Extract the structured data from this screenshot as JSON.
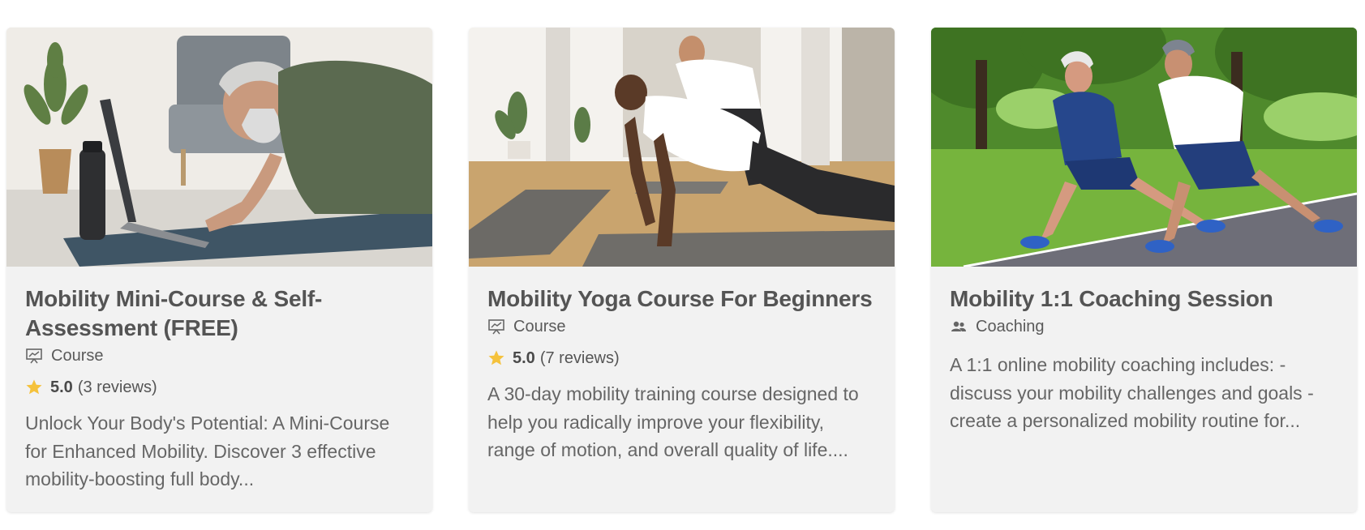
{
  "cards": [
    {
      "title": "Mobility Mini-Course & Self-Assessment (FREE)",
      "type_label": "Course",
      "type_icon": "presentation-chart-icon",
      "rating_score": "5.0",
      "rating_reviews": "(3 reviews)",
      "description": "Unlock Your Body's Potential: A Mini-Course for Enhanced Mobility. Discover 3 effective mobility-boosting full body..."
    },
    {
      "title": "Mobility Yoga Course For Beginners",
      "type_label": "Course",
      "type_icon": "presentation-chart-icon",
      "rating_score": "5.0",
      "rating_reviews": "(7 reviews)",
      "description": "A 30-day mobility training course designed to help you radically improve your flexibility, range of motion, and overall quality of life...."
    },
    {
      "title": "Mobility 1:1 Coaching Session",
      "type_label": "Coaching",
      "type_icon": "people-icon",
      "description": "A 1:1 online mobility coaching includes: - discuss your mobility challenges and goals - create a personalized mobility routine for..."
    }
  ],
  "colors": {
    "card_bg": "#f2f2f2",
    "star": "#f5c23c",
    "title": "#545454",
    "text": "#666666"
  }
}
